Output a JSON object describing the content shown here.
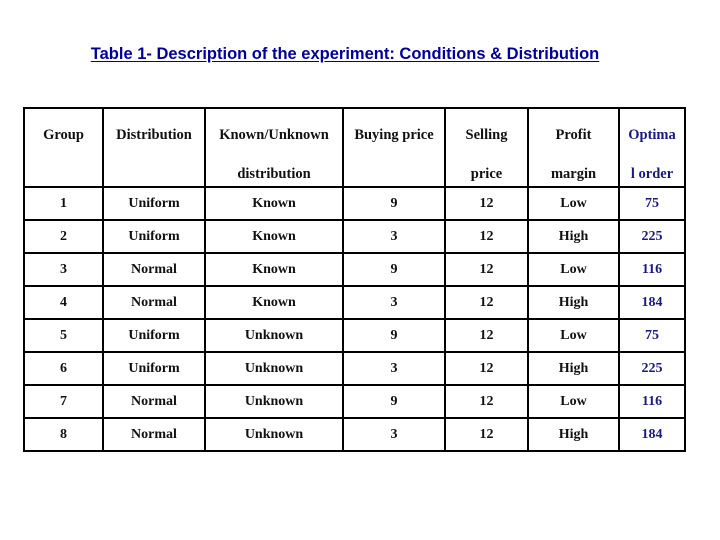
{
  "title": "Table 1- Description of the experiment: Conditions & Distribution",
  "table": {
    "headers": [
      {
        "line1": "Group",
        "line2": ""
      },
      {
        "line1": "Distribution",
        "line2": ""
      },
      {
        "line1": "Known/Unknown",
        "line2": "distribution"
      },
      {
        "line1": "Buying price",
        "line2": ""
      },
      {
        "line1": "Selling",
        "line2": "price"
      },
      {
        "line1": "Profit",
        "line2": "margin"
      },
      {
        "line1": "Optima",
        "line2": "l order"
      }
    ],
    "rows": [
      [
        "1",
        "Uniform",
        "Known",
        "9",
        "12",
        "Low",
        "75"
      ],
      [
        "2",
        "Uniform",
        "Known",
        "3",
        "12",
        "High",
        "225"
      ],
      [
        "3",
        "Normal",
        "Known",
        "9",
        "12",
        "Low",
        "116"
      ],
      [
        "4",
        "Normal",
        "Known",
        "3",
        "12",
        "High",
        "184"
      ],
      [
        "5",
        "Uniform",
        "Unknown",
        "9",
        "12",
        "Low",
        "75"
      ],
      [
        "6",
        "Uniform",
        "Unknown",
        "3",
        "12",
        "High",
        "225"
      ],
      [
        "7",
        "Normal",
        "Unknown",
        "9",
        "12",
        "Low",
        "116"
      ],
      [
        "8",
        "Normal",
        "Unknown",
        "3",
        "12",
        "High",
        "184"
      ]
    ]
  },
  "colors": {
    "title": "#000099",
    "optimal_order": "#1a1a80"
  }
}
